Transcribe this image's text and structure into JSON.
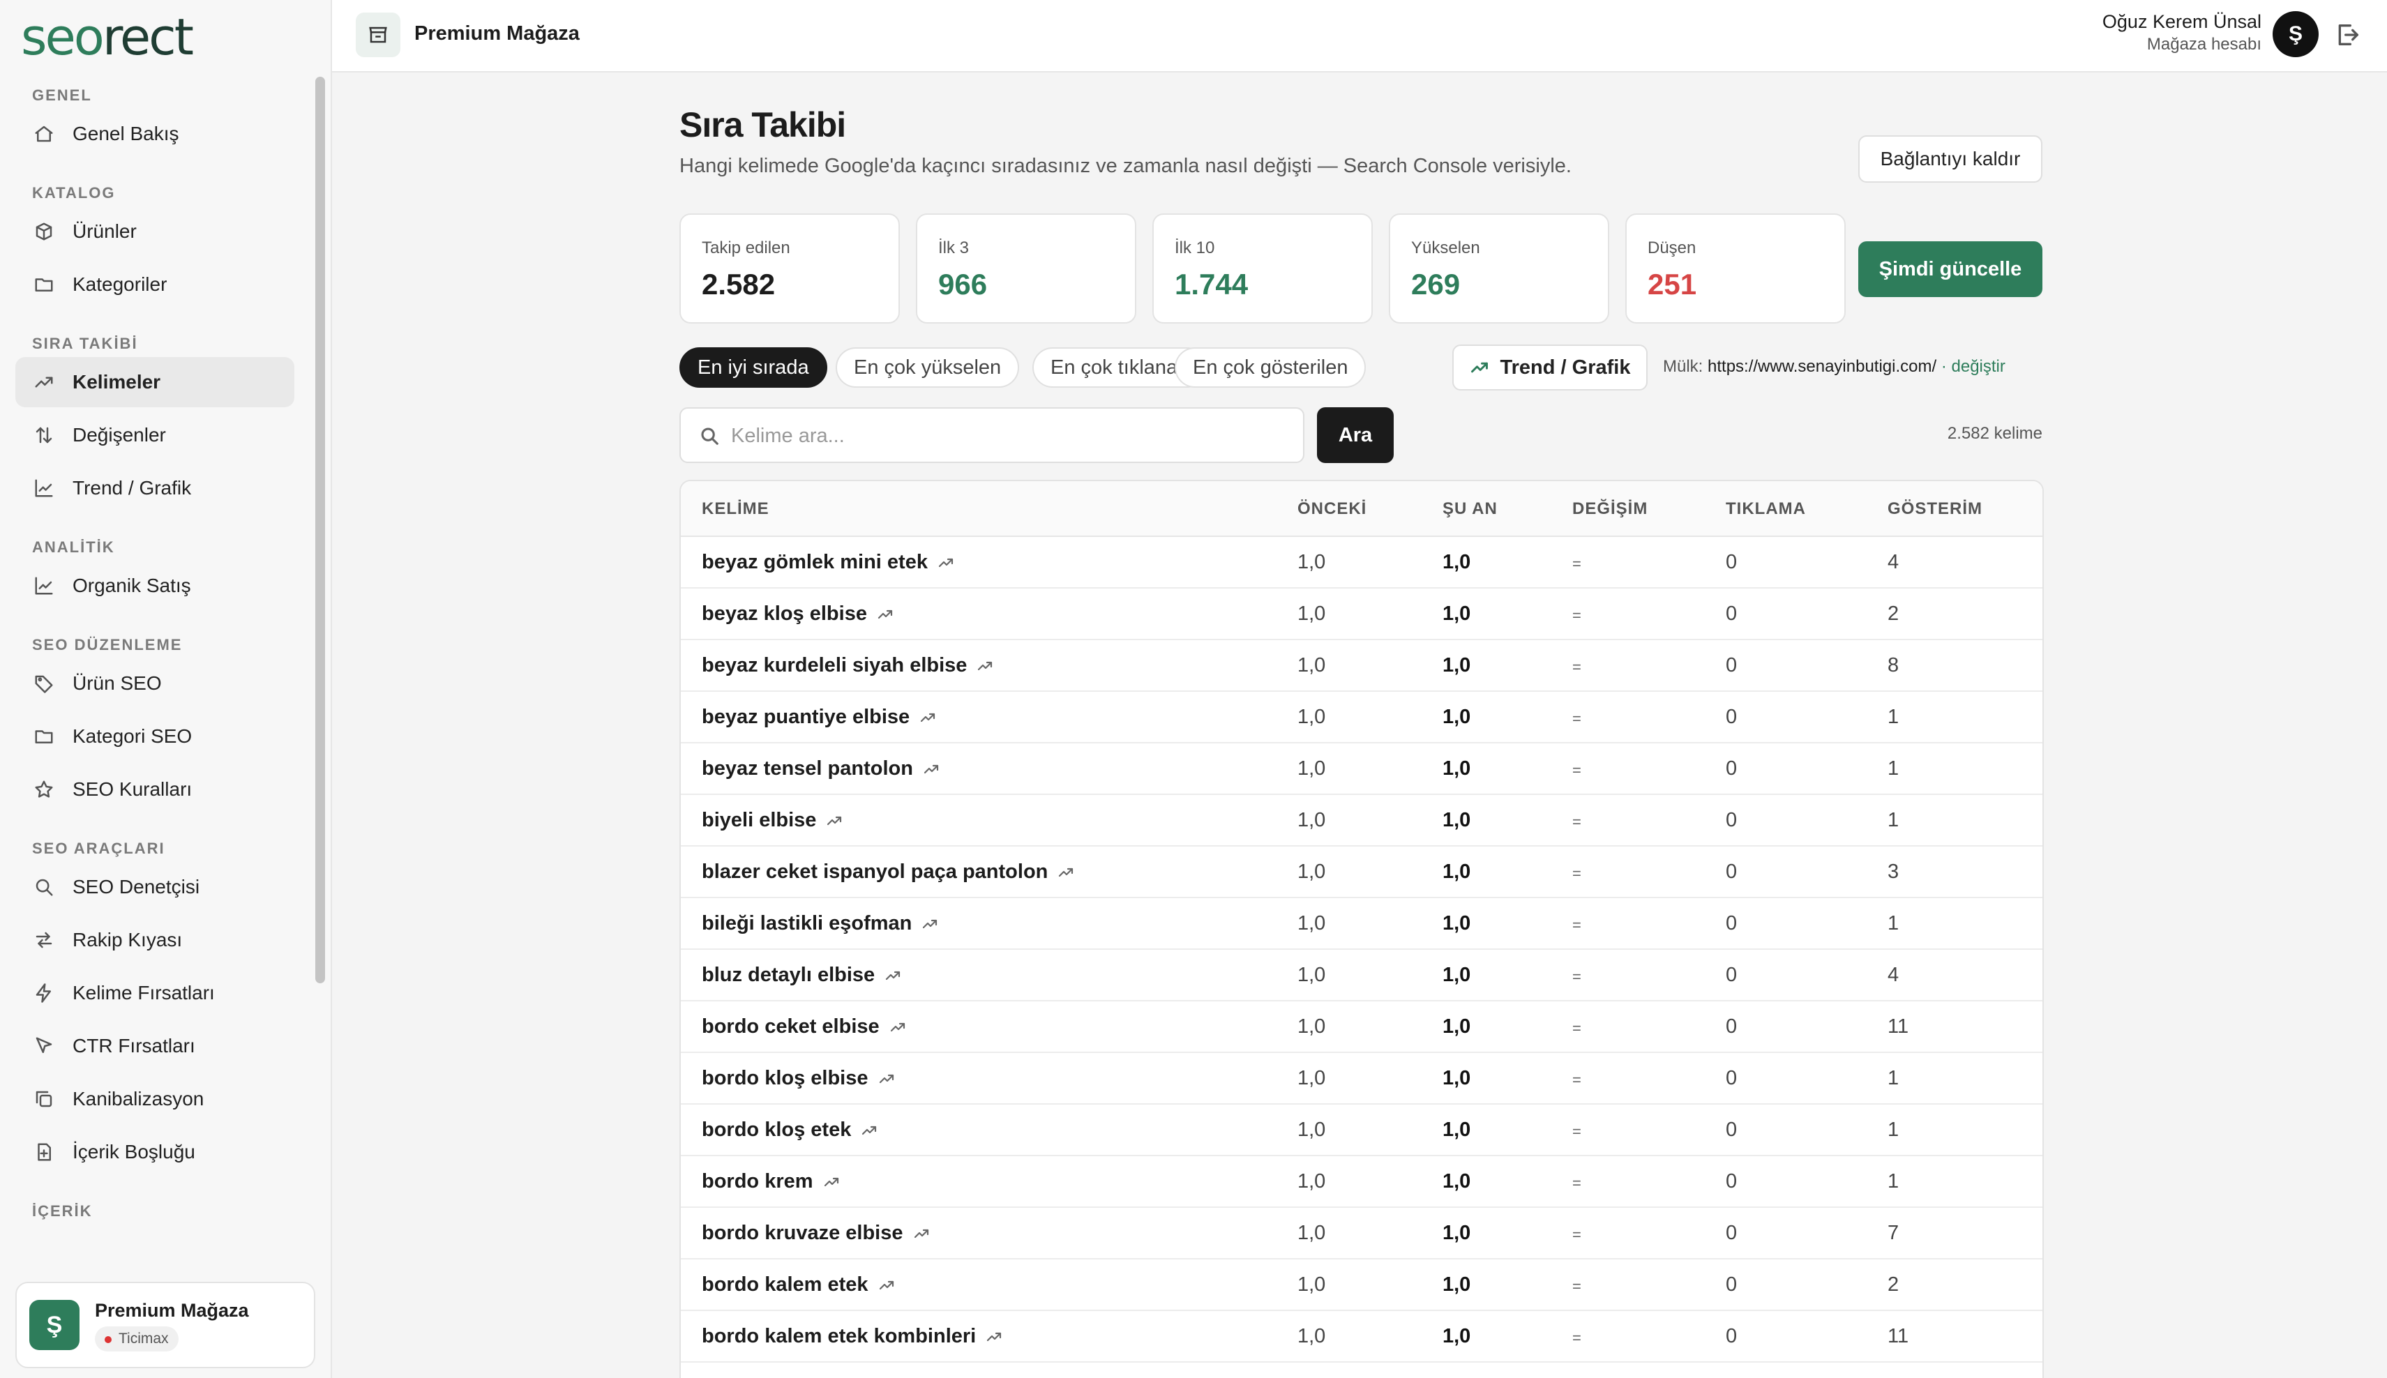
{
  "sidebar": {
    "logo_part1": "seo",
    "logo_part2": "rect",
    "sections": [
      {
        "title": "GENEL",
        "items": [
          {
            "label": "Genel Bakış",
            "icon": "home-icon"
          }
        ]
      },
      {
        "title": "KATALOG",
        "items": [
          {
            "label": "Ürünler",
            "icon": "box-icon"
          },
          {
            "label": "Kategoriler",
            "icon": "folder-icon"
          }
        ]
      },
      {
        "title": "SIRA TAKİBİ",
        "items": [
          {
            "label": "Kelimeler",
            "icon": "trend-icon",
            "active": true
          },
          {
            "label": "Değişenler",
            "icon": "arrows-icon"
          },
          {
            "label": "Trend / Grafik",
            "icon": "chart-icon"
          }
        ]
      },
      {
        "title": "ANALİTİK",
        "items": [
          {
            "label": "Organik Satış",
            "icon": "chart-icon"
          }
        ]
      },
      {
        "title": "SEO DÜZENLEME",
        "items": [
          {
            "label": "Ürün SEO",
            "icon": "tag-icon"
          },
          {
            "label": "Kategori SEO",
            "icon": "folder-icon"
          },
          {
            "label": "SEO Kuralları",
            "icon": "star-icon"
          }
        ]
      },
      {
        "title": "SEO ARAÇLARI",
        "items": [
          {
            "label": "SEO Denetçisi",
            "icon": "search-icon"
          },
          {
            "label": "Rakip Kıyası",
            "icon": "compare-icon"
          },
          {
            "label": "Kelime Fırsatları",
            "icon": "bolt-icon"
          },
          {
            "label": "CTR Fırsatları",
            "icon": "cursor-icon"
          },
          {
            "label": "Kanibalizasyon",
            "icon": "copy-icon"
          },
          {
            "label": "İçerik Boşluğu",
            "icon": "file-plus-icon"
          }
        ]
      },
      {
        "title": "İÇERİK",
        "items": []
      }
    ],
    "store": {
      "avatar": "Ş",
      "name": "Premium Mağaza",
      "badge": "Ticimax"
    }
  },
  "topbar": {
    "shop_title": "Premium Mağaza",
    "user_name": "Oğuz Kerem Ünsal",
    "user_role": "Mağaza hesabı",
    "user_avatar": "Ş"
  },
  "page": {
    "title": "Sıra Takibi",
    "subtitle": "Hangi kelimede Google'da kaçıncı sıradasınız ve zamanla nasıl değişti — Search Console verisiyle.",
    "disconnect_label": "Bağlantıyı kaldır",
    "refresh_label": "Şimdi güncelle",
    "stats": [
      {
        "label": "Takip edilen",
        "value": "2.582",
        "color": "#1c1c1c"
      },
      {
        "label": "İlk 3",
        "value": "966",
        "color": "#2e7d5b"
      },
      {
        "label": "İlk 10",
        "value": "1.744",
        "color": "#2e7d5b"
      },
      {
        "label": "Yükselen",
        "value": "269",
        "color": "#2e7d5b"
      },
      {
        "label": "Düşen",
        "value": "251",
        "color": "#d64545"
      }
    ],
    "filters": [
      "En iyi sırada",
      "En çok yükselen",
      "En çok tıklanan",
      "En çok gösterilen"
    ],
    "trend_label": "Trend / Grafik",
    "property_prefix": "Mülk:",
    "property_url": "https://www.senayinbutigi.com/",
    "property_change": "· değiştir",
    "search_placeholder": "Kelime ara...",
    "search_value": "",
    "search_button": "Ara",
    "count_label": "2.582 kelime"
  },
  "table": {
    "headers": [
      "KELİME",
      "ÖNCEKİ",
      "ŞU AN",
      "DEĞİŞİM",
      "TIKLAMA",
      "GÖSTERİM"
    ],
    "rows": [
      {
        "kw": "beyaz gömlek mini etek",
        "prev": "1,0",
        "now": "1,0",
        "chg": "=",
        "clicks": "0",
        "imp": "4"
      },
      {
        "kw": "beyaz kloş elbise",
        "prev": "1,0",
        "now": "1,0",
        "chg": "=",
        "clicks": "0",
        "imp": "2"
      },
      {
        "kw": "beyaz kurdeleli siyah elbise",
        "prev": "1,0",
        "now": "1,0",
        "chg": "=",
        "clicks": "0",
        "imp": "8"
      },
      {
        "kw": "beyaz puantiye elbise",
        "prev": "1,0",
        "now": "1,0",
        "chg": "=",
        "clicks": "0",
        "imp": "1"
      },
      {
        "kw": "beyaz tensel pantolon",
        "prev": "1,0",
        "now": "1,0",
        "chg": "=",
        "clicks": "0",
        "imp": "1"
      },
      {
        "kw": "biyeli elbise",
        "prev": "1,0",
        "now": "1,0",
        "chg": "=",
        "clicks": "0",
        "imp": "1"
      },
      {
        "kw": "blazer ceket ispanyol paça pantolon",
        "prev": "1,0",
        "now": "1,0",
        "chg": "=",
        "clicks": "0",
        "imp": "3"
      },
      {
        "kw": "bileği lastikli eşofman",
        "prev": "1,0",
        "now": "1,0",
        "chg": "=",
        "clicks": "0",
        "imp": "1"
      },
      {
        "kw": "bluz detaylı elbise",
        "prev": "1,0",
        "now": "1,0",
        "chg": "=",
        "clicks": "0",
        "imp": "4"
      },
      {
        "kw": "bordo ceket elbise",
        "prev": "1,0",
        "now": "1,0",
        "chg": "=",
        "clicks": "0",
        "imp": "11"
      },
      {
        "kw": "bordo kloş elbise",
        "prev": "1,0",
        "now": "1,0",
        "chg": "=",
        "clicks": "0",
        "imp": "1"
      },
      {
        "kw": "bordo kloş etek",
        "prev": "1,0",
        "now": "1,0",
        "chg": "=",
        "clicks": "0",
        "imp": "1"
      },
      {
        "kw": "bordo krem",
        "prev": "1,0",
        "now": "1,0",
        "chg": "=",
        "clicks": "0",
        "imp": "1"
      },
      {
        "kw": "bordo kruvaze elbise",
        "prev": "1,0",
        "now": "1,0",
        "chg": "=",
        "clicks": "0",
        "imp": "7"
      },
      {
        "kw": "bordo kalem etek",
        "prev": "1,0",
        "now": "1,0",
        "chg": "=",
        "clicks": "0",
        "imp": "2"
      },
      {
        "kw": "bordo kalem etek kombinleri",
        "prev": "1,0",
        "now": "1,0",
        "chg": "=",
        "clicks": "0",
        "imp": "11"
      }
    ]
  },
  "colors": {
    "accent": "#2e7d5b",
    "danger": "#d64545",
    "dark": "#1b1b1b"
  }
}
